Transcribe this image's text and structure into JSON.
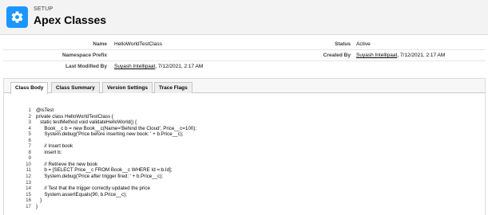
{
  "header": {
    "section_label": "SETUP",
    "title": "Apex Classes",
    "icon": "gear-icon",
    "icon_bg": "#1b96ff"
  },
  "details": {
    "name_label": "Name",
    "name_value": "HelloWorldTestClass",
    "status_label": "Status",
    "status_value": "Active",
    "namespace_label": "Namespace Prefix",
    "namespace_value": "",
    "created_by_label": "Created By",
    "created_by_user": "Suyash Intellipaat",
    "created_by_date": ", 7/12/2021, 2:17 AM",
    "modified_by_label": "Last Modified By",
    "modified_by_user": "Suyash Intellipaat",
    "modified_by_date": ", 7/12/2021, 2:17 AM"
  },
  "tabs": [
    {
      "label": "Class Body",
      "active": true
    },
    {
      "label": "Class Summary",
      "active": false
    },
    {
      "label": "Version Settings",
      "active": false
    },
    {
      "label": "Trace Flags",
      "active": false
    }
  ],
  "code_lines": [
    {
      "n": "1",
      "text": "@isTest"
    },
    {
      "n": "2",
      "text": "private class HelloWorldTestClass {"
    },
    {
      "n": "3",
      "text": "   static testMethod void validateHelloWorld() {"
    },
    {
      "n": "4",
      "text": "      Book__c b = new Book__c(Name='Behind the Cloud', Price__c=100);"
    },
    {
      "n": "5",
      "text": "      System.debug('Price before inserting new book: ' + b.Price__c);"
    },
    {
      "n": "6",
      "text": ""
    },
    {
      "n": "7",
      "text": "      // Insert book"
    },
    {
      "n": "8",
      "text": "      insert b;"
    },
    {
      "n": "9",
      "text": ""
    },
    {
      "n": "10",
      "text": "      // Retrieve the new book"
    },
    {
      "n": "11",
      "text": "      b = [SELECT Price__c FROM Book__c WHERE Id =:b.Id];"
    },
    {
      "n": "12",
      "text": "      System.debug('Price after trigger fired: ' + b.Price__c);"
    },
    {
      "n": "13",
      "text": ""
    },
    {
      "n": "14",
      "text": "      // Test that the trigger correctly updated the price"
    },
    {
      "n": "15",
      "text": "      System.assertEquals(90, b.Price__c);"
    },
    {
      "n": "16",
      "text": "   }"
    },
    {
      "n": "17",
      "text": "}"
    }
  ]
}
